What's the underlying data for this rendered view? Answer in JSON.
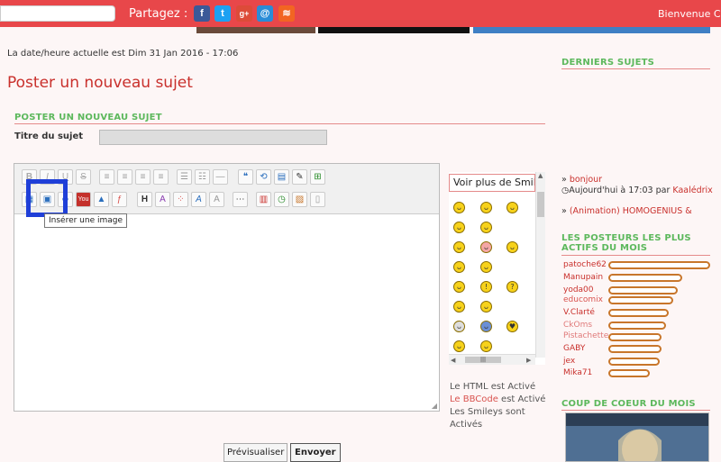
{
  "topbar": {
    "partagez_label": "Partagez :",
    "social_icons": [
      {
        "name": "facebook-icon",
        "glyph": "f",
        "color": "#3b5998"
      },
      {
        "name": "twitter-icon",
        "glyph": "t",
        "color": "#1da1f2"
      },
      {
        "name": "google-plus-icon",
        "glyph": "g+",
        "color": "#dd4b39"
      },
      {
        "name": "email-icon",
        "glyph": "@",
        "color": "#2a8cd7"
      },
      {
        "name": "rss-icon",
        "glyph": "≋",
        "color": "#f26522"
      }
    ],
    "welcome": "Bienvenue Ck"
  },
  "main": {
    "datetime": "La date/heure actuelle est Dim 31 Jan 2016 - 17:06",
    "page_title": "Poster un nouveau sujet",
    "section_title": "POSTER UN NOUVEAU SUJET",
    "subject_label": "Titre du sujet",
    "tooltip": "Insérer une image",
    "voir_plus": "Voir plus de Smileys",
    "status_line1": "Le HTML est Activé",
    "status_bbcode_link": "Le BBCode",
    "status_bbcode_rest": " est Activé",
    "status_smileys": "Les Smileys sont Activés",
    "preview_button": "Prévisualiser",
    "send_button": "Envoyer"
  },
  "sidebar": {
    "derniers_title": "DERNIERS SUJETS",
    "topic1_title": "bonjour",
    "topic1_meta_prefix": "Aujourd'hui à 17:03 par ",
    "topic1_author": "Kaalédrix",
    "topic2_title": "(Animation) HOMOGENIUS &",
    "posteurs_title_line1": "LES POSTEURS LES PLUS",
    "posteurs_title_line2": "ACTIFS DU MOIS",
    "posters": [
      {
        "name": "patoche62",
        "level": 1.0,
        "color": "#c9302c"
      },
      {
        "name": "Manupain",
        "level": 0.73,
        "color": "#c9302c"
      },
      {
        "name": "yoda00",
        "level": 0.68,
        "color": "#c9302c"
      },
      {
        "name": "educomix",
        "level": 0.64,
        "color": "#d9534f"
      },
      {
        "name": "V.Clarté",
        "level": 0.59,
        "color": "#c9302c"
      },
      {
        "name": "CkOms",
        "level": 0.57,
        "color": "#e07a7a"
      },
      {
        "name": "Pistachette",
        "level": 0.52,
        "color": "#e07a7a"
      },
      {
        "name": "GABY",
        "level": 0.52,
        "color": "#c9302c"
      },
      {
        "name": "jex",
        "level": 0.5,
        "color": "#c9302c"
      },
      {
        "name": "Mika71",
        "level": 0.41,
        "color": "#c9302c"
      }
    ],
    "coup_title": "COUP DE COEUR DU MOIS"
  }
}
